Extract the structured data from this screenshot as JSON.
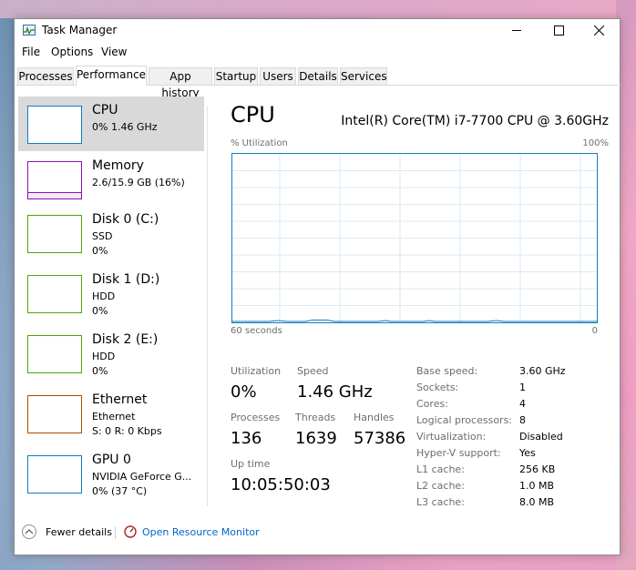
{
  "window": {
    "title": "Task Manager"
  },
  "menu": [
    "File",
    "Options",
    "View"
  ],
  "tabs": [
    "Processes",
    "Performance",
    "App history",
    "Startup",
    "Users",
    "Details",
    "Services"
  ],
  "active_tab": "Performance",
  "sidebar": {
    "items": [
      {
        "name": "CPU",
        "sub1": "0% 1.46 GHz",
        "sub2": "",
        "color": "#117dbb"
      },
      {
        "name": "Memory",
        "sub1": "2.6/15.9 GB (16%)",
        "sub2": "",
        "color": "#8b12ae"
      },
      {
        "name": "Disk 0 (C:)",
        "sub1": "SSD",
        "sub2": "0%",
        "color": "#4da60c"
      },
      {
        "name": "Disk 1 (D:)",
        "sub1": "HDD",
        "sub2": "0%",
        "color": "#4da60c"
      },
      {
        "name": "Disk 2 (E:)",
        "sub1": "HDD",
        "sub2": "0%",
        "color": "#4da60c"
      },
      {
        "name": "Ethernet",
        "sub1": "Ethernet",
        "sub2": "S: 0 R: 0 Kbps",
        "color": "#a74f01"
      },
      {
        "name": "GPU 0",
        "sub1": "NVIDIA GeForce G...",
        "sub2": "0% (37 °C)",
        "color": "#117dbb"
      }
    ]
  },
  "main": {
    "title": "CPU",
    "model": "Intel(R) Core(TM) i7-7700 CPU @ 3.60GHz",
    "util_label": "% Utilization",
    "util_max": "100%",
    "axis_left": "60 seconds",
    "axis_right": "0",
    "stats": {
      "utilization_label": "Utilization",
      "utilization": "0%",
      "speed_label": "Speed",
      "speed": "1.46 GHz",
      "processes_label": "Processes",
      "processes": "136",
      "threads_label": "Threads",
      "threads": "1639",
      "handles_label": "Handles",
      "handles": "57386",
      "uptime_label": "Up time",
      "uptime": "10:05:50:03"
    },
    "specs": [
      {
        "label": "Base speed:",
        "value": "3.60 GHz"
      },
      {
        "label": "Sockets:",
        "value": "1"
      },
      {
        "label": "Cores:",
        "value": "4"
      },
      {
        "label": "Logical processors:",
        "value": "8"
      },
      {
        "label": "Virtualization:",
        "value": "Disabled"
      },
      {
        "label": "Hyper-V support:",
        "value": "Yes"
      },
      {
        "label": "L1 cache:",
        "value": "256 KB"
      },
      {
        "label": "L2 cache:",
        "value": "1.0 MB"
      },
      {
        "label": "L3 cache:",
        "value": "8.0 MB"
      }
    ]
  },
  "footer": {
    "fewer_details": "Fewer details",
    "open_monitor": "Open Resource Monitor"
  },
  "colors": {
    "cpu_accent": "#117dbb",
    "link": "#0066cc",
    "grid": "#d9eaf4"
  }
}
